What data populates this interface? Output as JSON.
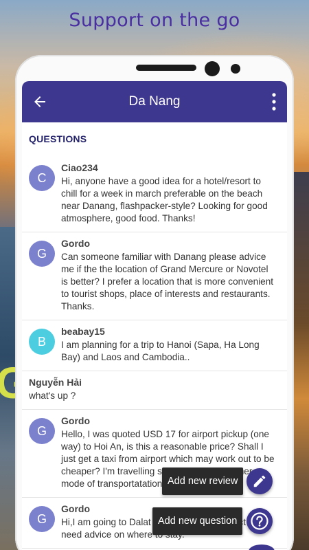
{
  "headline": "Support on the go",
  "appbar": {
    "title": "Da Nang"
  },
  "section": {
    "title": "QUESTIONS"
  },
  "questions": [
    {
      "initial": "C",
      "author": "Ciao234",
      "color": "#7b81cc",
      "text": "Hi, anyone have a good idea for a hotel/resort to chill for a week in march preferable on the beach near Danang, flashpacker-style? Looking for good atmosphere, good food. Thanks!"
    },
    {
      "initial": "G",
      "author": "Gordo",
      "color": "#7b81cc",
      "text": "Can someone familiar with Danang please advice me if the the location of Grand Mercure or Novotel is better? I prefer a location that is more convenient to tourist shops, place of interests and restaurants. Thanks."
    },
    {
      "initial": "B",
      "author": "beabay15",
      "color": "#4dcde0",
      "text": "I am planning for a trip to Hanoi (Sapa, Ha Long Bay) and Laos and Cambodia.."
    },
    {
      "initial": "",
      "author": "Nguyễn Hải",
      "color": "",
      "text": "what's up ?"
    },
    {
      "initial": "G",
      "author": "Gordo",
      "color": "#7b81cc",
      "text": "Hello, I was quoted USD 17 for airport pickup (one way) to Hoi An, is this a reasonable price? Shall I just get a taxi from airport which may work out to be cheaper? I'm travelling solo. Is there any other mode of transportatation other than taxi?"
    },
    {
      "initial": "G",
      "author": "Gordo",
      "color": "#7b81cc",
      "text": "Hi,I am going to Dalat in the first week of Oct and I need advice on where to stay."
    }
  ],
  "actions": {
    "add_review": "Add new review",
    "add_question": "Add new question"
  },
  "icons": {
    "back": "arrow-left-icon",
    "more": "more-vertical-icon",
    "review": "pencil-icon",
    "question": "help-circle-icon"
  },
  "colors": {
    "primary": "#3e3790",
    "headline": "#4a2fa0",
    "section_title": "#24236b"
  }
}
